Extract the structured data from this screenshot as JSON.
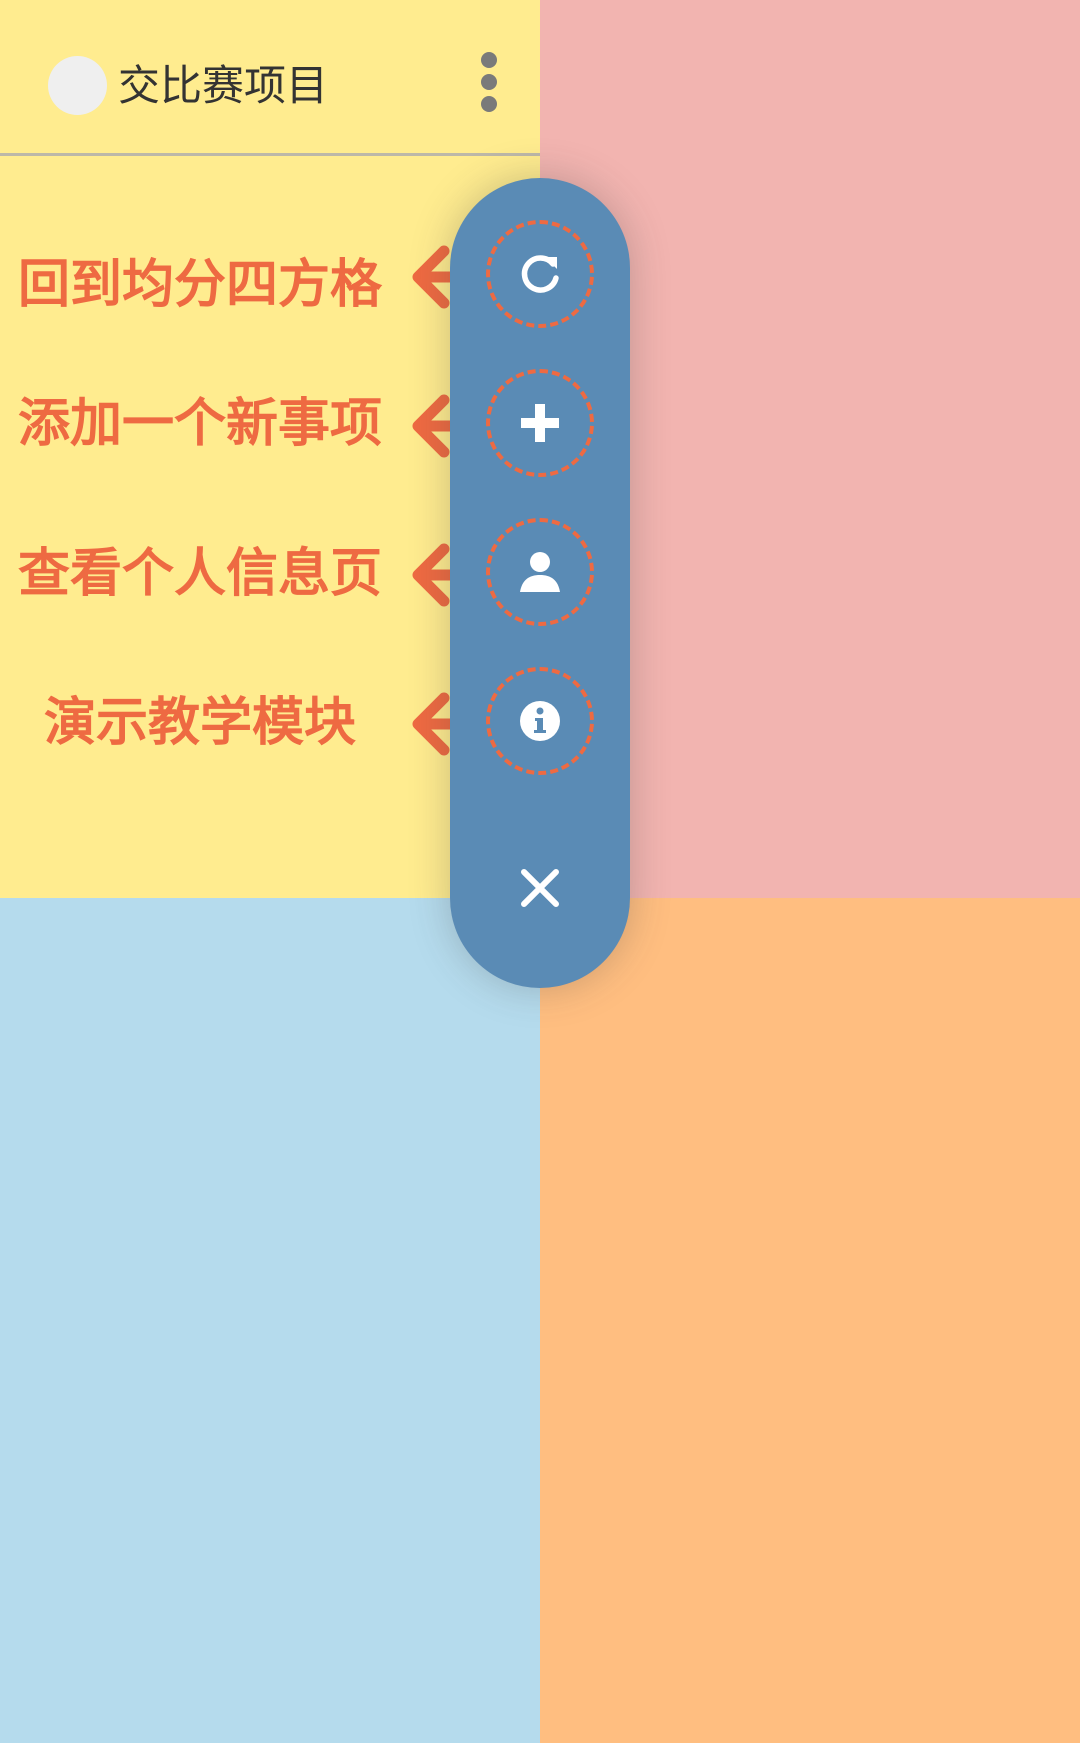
{
  "card": {
    "title": "交比赛项目"
  },
  "tutorial": {
    "hints": [
      {
        "label": "回到均分四方格",
        "icon": "refresh-icon"
      },
      {
        "label": "添加一个新事项",
        "icon": "plus-icon"
      },
      {
        "label": "查看个人信息页",
        "icon": "person-icon"
      },
      {
        "label": "演示教学模块",
        "icon": "info-icon"
      }
    ],
    "close_icon": "close-icon"
  },
  "colors": {
    "quadrant_yellow": "#FFEC8F",
    "quadrant_pink": "#F2B4B0",
    "quadrant_blue": "#B5DBED",
    "quadrant_orange": "#FFBE80",
    "fab_background": "#5A8BB5",
    "accent": "#EE6A42"
  }
}
